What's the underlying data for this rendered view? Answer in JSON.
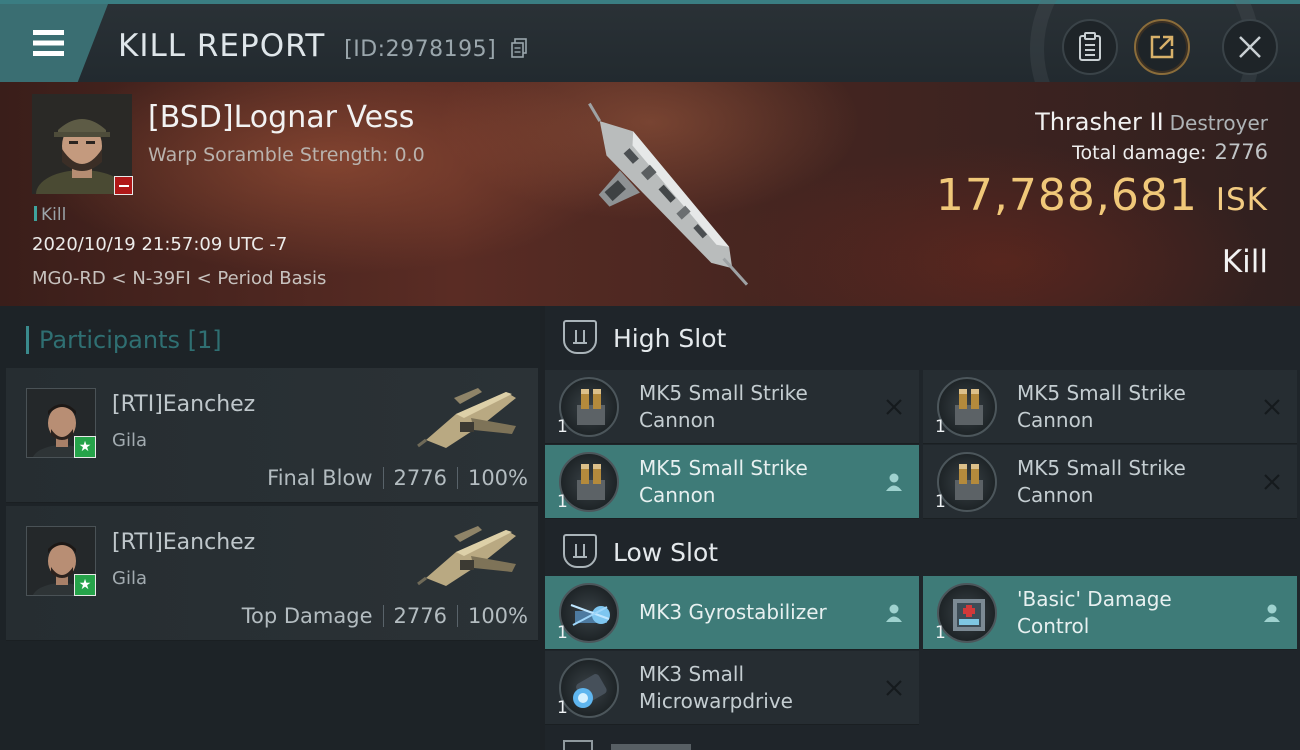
{
  "header": {
    "title": "KILL REPORT",
    "id_label": "[ID:2978195]",
    "icons": [
      "menu-icon",
      "copy-icon",
      "clipboard-icon",
      "share-icon",
      "close-icon"
    ]
  },
  "victim": {
    "name": "[BSD]Lognar Vess",
    "scramble": "Warp Soramble Strength: 0.0",
    "tag": "Kill",
    "datetime": "2020/10/19 21:57:09 UTC -7",
    "location": "MG0-RD < N-39FI < Period Basis",
    "ship_name": "Thrasher II",
    "ship_class": "Destroyer",
    "damage_label": "Total damage:",
    "damage_value": "2776",
    "isk_value": "17,788,681",
    "isk_unit": "ISK",
    "result": "Kill"
  },
  "participants": {
    "title": "Participants",
    "count": "[1]",
    "items": [
      {
        "name": "[RTI]Eanchez",
        "ship": "Gila",
        "role": "Final Blow",
        "damage": "2776",
        "percent": "100%"
      },
      {
        "name": "[RTI]Eanchez",
        "ship": "Gila",
        "role": "Top Damage",
        "damage": "2776",
        "percent": "100%"
      }
    ]
  },
  "fitting": {
    "high_slot": {
      "label": "High Slot",
      "items": [
        {
          "qty": "1",
          "line1": "MK5 Small Strike",
          "line2": "Cannon",
          "status": "destroyed"
        },
        {
          "qty": "1",
          "line1": "MK5 Small Strike",
          "line2": "Cannon",
          "status": "destroyed"
        },
        {
          "qty": "1",
          "line1": "MK5 Small Strike",
          "line2": "Cannon",
          "status": "dropped"
        },
        {
          "qty": "1",
          "line1": "MK5 Small Strike",
          "line2": "Cannon",
          "status": "destroyed"
        }
      ]
    },
    "low_slot": {
      "label": "Low Slot",
      "items": [
        {
          "qty": "1",
          "line1": "MK3 Gyrostabilizer",
          "line2": "",
          "status": "dropped"
        },
        {
          "qty": "1",
          "line1": "'Basic' Damage",
          "line2": "Control",
          "status": "dropped"
        },
        {
          "qty": "1",
          "line1": "MK3 Small",
          "line2": "Microwarpdrive",
          "status": "destroyed"
        }
      ]
    }
  },
  "colors": {
    "accent_teal": "#3e7b78",
    "isk_gold": "#f0c879",
    "minus_red": "#b01818",
    "star_green": "#26a34a"
  }
}
